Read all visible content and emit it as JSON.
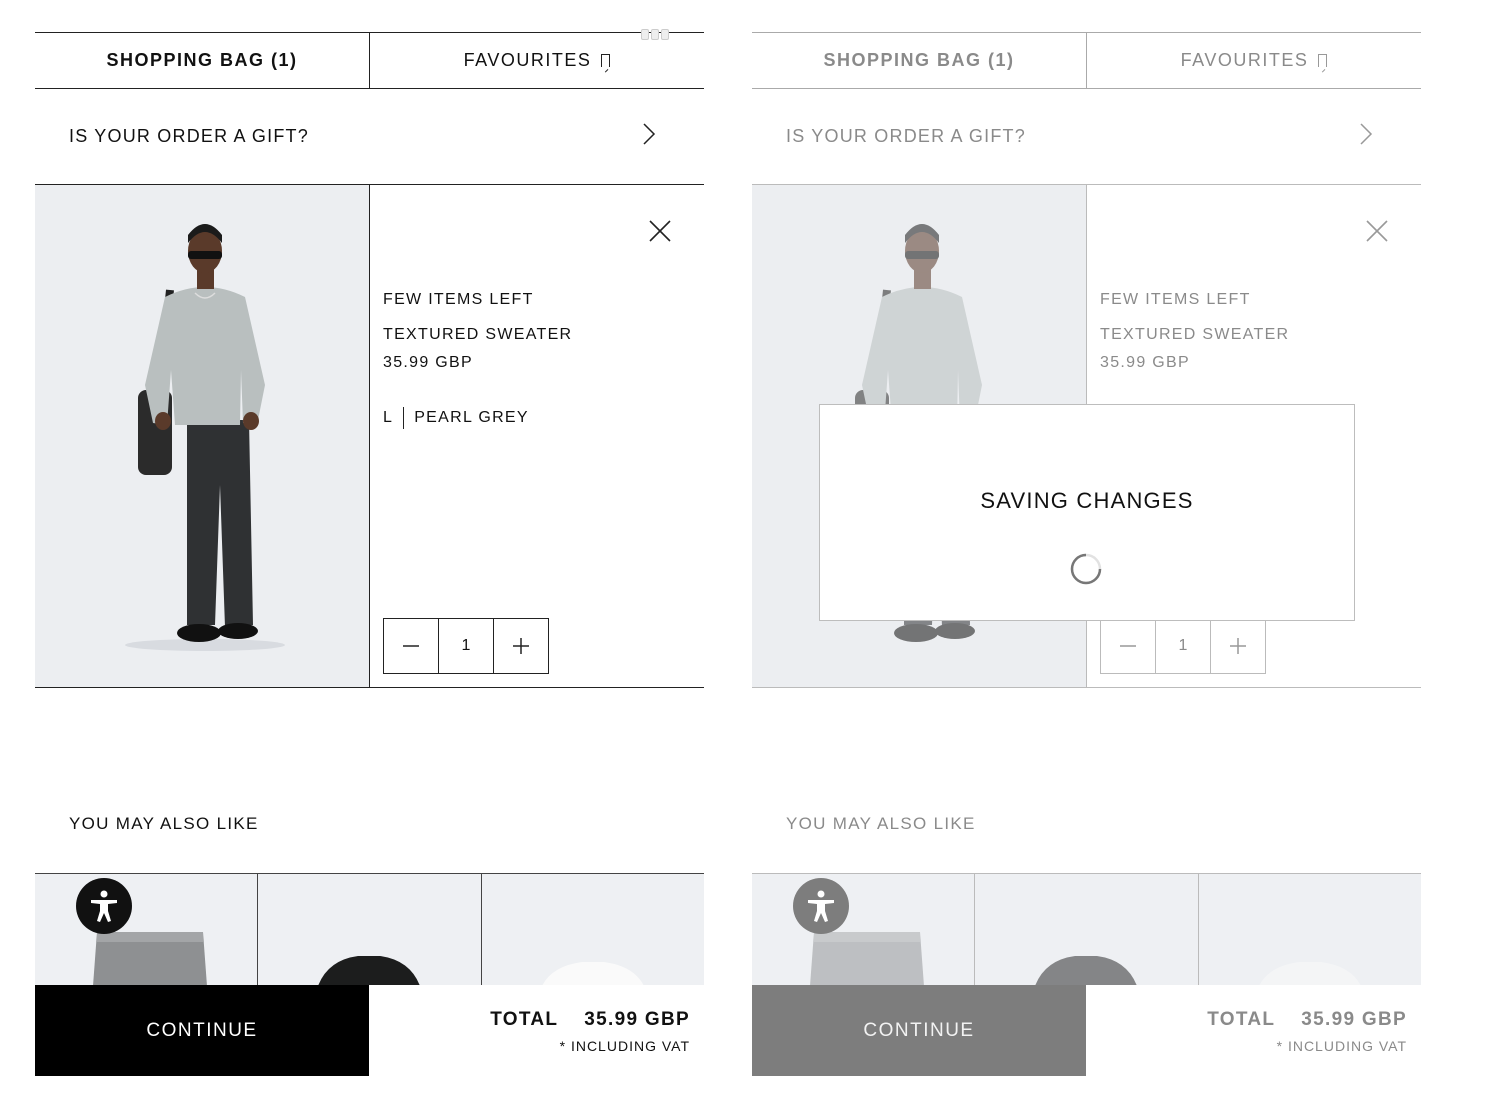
{
  "tabs": {
    "shopping_bag": "SHOPPING BAG (1)",
    "favourites": "FAVOURITES"
  },
  "gift": {
    "label": "IS YOUR ORDER A GIFT?"
  },
  "product": {
    "stock": "FEW ITEMS LEFT",
    "name": "TEXTURED SWEATER",
    "price": "35.99 GBP",
    "size": "L",
    "color": "PEARL GREY",
    "quantity": "1"
  },
  "recommendations": {
    "title": "YOU MAY ALSO LIKE"
  },
  "footer": {
    "continue": "CONTINUE",
    "total_label": "TOTAL",
    "total_value": "35.99 GBP",
    "vat_note": "* INCLUDING VAT"
  },
  "overlay": {
    "title": "SAVING CHANGES"
  },
  "icons": {
    "bookmark": "bookmark-icon",
    "chevron": "chevron-right-icon",
    "close": "close-icon",
    "minus": "minus-icon",
    "plus": "plus-icon",
    "accessibility": "accessibility-icon",
    "spinner": "loading-spinner-icon"
  },
  "colors": {
    "primary": "#000000",
    "disabled_button": "#7d7d7d",
    "background": "#ffffff",
    "image_bg": "#eceef1"
  }
}
